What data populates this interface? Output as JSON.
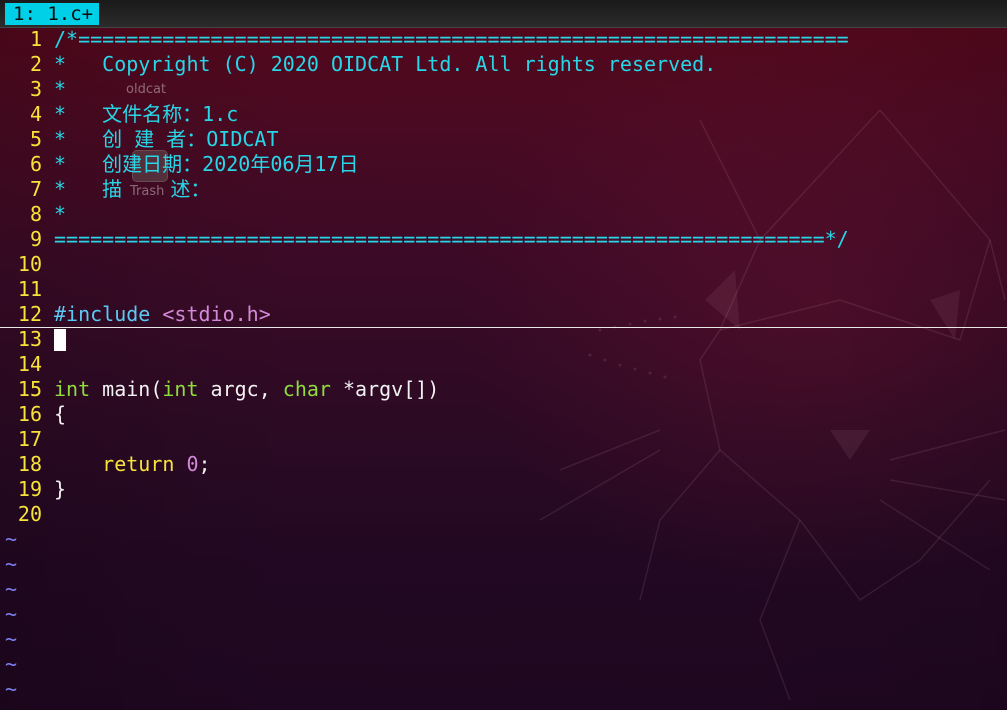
{
  "tabline": {
    "active_tab": "1: 1.c+"
  },
  "desktop": {
    "icon_1_label": "oldcat",
    "icon_2_label": "Trash"
  },
  "editor": {
    "lines": [
      {
        "num": "1",
        "segments": [
          {
            "cls": "c-comment",
            "text": "/*================================================================"
          }
        ]
      },
      {
        "num": "2",
        "segments": [
          {
            "cls": "c-comment",
            "text": "*   Copyright (C) 2020 OIDCAT Ltd. All rights reserved."
          }
        ]
      },
      {
        "num": "3",
        "segments": [
          {
            "cls": "c-comment",
            "text": "*"
          }
        ]
      },
      {
        "num": "4",
        "segments": [
          {
            "cls": "c-comment",
            "text": "*   文件名称：1.c"
          }
        ]
      },
      {
        "num": "5",
        "segments": [
          {
            "cls": "c-comment",
            "text": "*   创 建 者：OIDCAT"
          }
        ]
      },
      {
        "num": "6",
        "segments": [
          {
            "cls": "c-comment",
            "text": "*   创建日期：2020年06月17日"
          }
        ]
      },
      {
        "num": "7",
        "segments": [
          {
            "cls": "c-comment",
            "text": "*   描    述："
          }
        ]
      },
      {
        "num": "8",
        "segments": [
          {
            "cls": "c-comment",
            "text": "*"
          }
        ]
      },
      {
        "num": "9",
        "segments": [
          {
            "cls": "c-comment",
            "text": "================================================================*/"
          }
        ]
      },
      {
        "num": "10",
        "segments": []
      },
      {
        "num": "11",
        "segments": []
      },
      {
        "num": "12",
        "segments": [
          {
            "cls": "c-pre",
            "text": "#include "
          },
          {
            "cls": "c-inc",
            "text": "<stdio.h>"
          }
        ]
      },
      {
        "num": "13",
        "segments": [],
        "cursor": true
      },
      {
        "num": "14",
        "segments": []
      },
      {
        "num": "15",
        "segments": [
          {
            "cls": "c-type",
            "text": "int"
          },
          {
            "cls": "c-plain",
            "text": " main("
          },
          {
            "cls": "c-type",
            "text": "int"
          },
          {
            "cls": "c-plain",
            "text": " argc, "
          },
          {
            "cls": "c-type",
            "text": "char"
          },
          {
            "cls": "c-plain",
            "text": " *argv[])"
          }
        ]
      },
      {
        "num": "16",
        "segments": [
          {
            "cls": "c-plain",
            "text": "{"
          }
        ]
      },
      {
        "num": "17",
        "segments": []
      },
      {
        "num": "18",
        "segments": [
          {
            "cls": "c-plain",
            "text": "    "
          },
          {
            "cls": "c-stmt",
            "text": "return"
          },
          {
            "cls": "c-plain",
            "text": " "
          },
          {
            "cls": "c-num",
            "text": "0"
          },
          {
            "cls": "c-plain",
            "text": ";"
          }
        ]
      },
      {
        "num": "19",
        "segments": [
          {
            "cls": "c-plain",
            "text": "}"
          }
        ]
      },
      {
        "num": "20",
        "segments": []
      }
    ],
    "filler_lines": [
      "~",
      "~",
      "~",
      "~",
      "~",
      "~",
      "~"
    ]
  },
  "colors": {
    "line_number": "#f8e33a",
    "comment": "#27d7e8",
    "preproc": "#5bc9f4",
    "include_path": "#d289d7",
    "type": "#8fdc3e",
    "statement": "#f8e33a",
    "tab_active_bg": "#00cfe8",
    "tilde": "#7e7ef0"
  }
}
